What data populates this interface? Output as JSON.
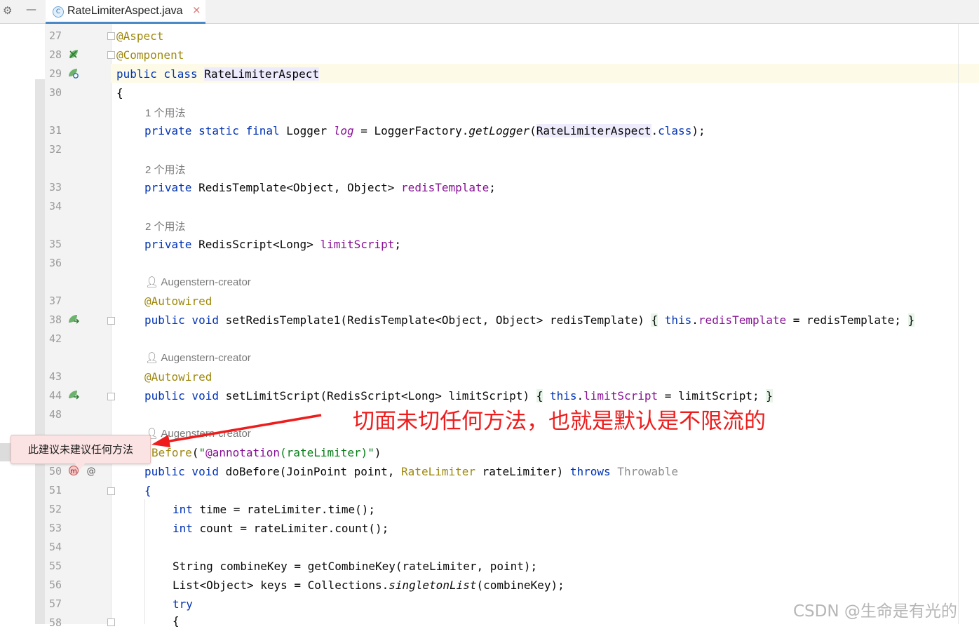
{
  "editor": {
    "tab": {
      "icon": "class-file-icon",
      "filename": "RateLimiterAspect.java",
      "close_glyph": "×"
    },
    "toolbar": {
      "settings_glyph": "⚙",
      "minimize_glyph": "—"
    },
    "gutter": {
      "line_numbers": [
        "27",
        "28",
        "29",
        "30",
        "31",
        "32",
        "33",
        "34",
        "35",
        "36",
        "37",
        "38",
        "42",
        "43",
        "44",
        "48",
        "50",
        "51",
        "52",
        "53",
        "54",
        "55",
        "56",
        "57",
        "58"
      ]
    },
    "hints": {
      "usages_1": "1 个用法",
      "usages_2": "2 个用法",
      "usages_3": "2 个用法",
      "author_1": "Augenstern-creator",
      "author_2": "Augenstern-creator",
      "author_3": "Augenstern-creator"
    }
  },
  "code": {
    "l27": "@Aspect",
    "l28": "@Component",
    "l29_kw": "public class ",
    "l29_name": "RateLimiterAspect",
    "l30": "{",
    "l31_kw": "private static final ",
    "l31_type": "Logger ",
    "l31_field": "log",
    "l31_eq": " = LoggerFactory.",
    "l31_method": "getLogger",
    "l31_paren": "(",
    "l31_arg": "RateLimiterAspect",
    "l31_dot": ".",
    "l31_class": "class",
    "l31_end": ");",
    "l33_kw": "private ",
    "l33_type": "RedisTemplate<Object, Object> ",
    "l33_field": "redisTemplate",
    "l33_end": ";",
    "l35_kw": "private ",
    "l35_type": "RedisScript<Long> ",
    "l35_field": "limitScript",
    "l35_end": ";",
    "l37": "@Autowired",
    "l38_kw": "public void ",
    "l38_sig": "setRedisTemplate1(RedisTemplate<Object, Object> redisTemplate) ",
    "l38_lb": "{",
    "l38_this": " this",
    "l38_dot": ".",
    "l38_field": "redisTemplate",
    "l38_rest": " = redisTemplate; ",
    "l38_rb": "}",
    "l43": "@Autowired",
    "l44_kw": "public void ",
    "l44_sig": "setLimitScript(RedisScript<Long> limitScript) ",
    "l44_lb": "{",
    "l44_this": " this",
    "l44_dot": ".",
    "l44_field": "limitScript",
    "l44_rest": " = limitScript; ",
    "l44_rb": "}",
    "l49_an": "Before",
    "l49_open": "(",
    "l49_str1": "\"",
    "l49_ann": "@annotation",
    "l49_str2": "(rateLimiter)\"",
    "l49_close": ")",
    "l50_kw": "public void ",
    "l50_sig": "doBefore(JoinPoint point, ",
    "l50_ann": "RateLimiter",
    "l50_rest": " rateLimiter) ",
    "l50_throws": "throws",
    "l50_exc": " Throwable",
    "l51": "{",
    "l52_kw": "int",
    "l52_rest": " time = rateLimiter.time();",
    "l53_kw": "int",
    "l53_rest": " count = rateLimiter.count();",
    "l55": "String combineKey = getCombineKey(rateLimiter, point);",
    "l56_a": "List<Object> keys = Collections.",
    "l56_m": "singletonList",
    "l56_b": "(combineKey);",
    "l57": "try",
    "l58": "{"
  },
  "annotations": {
    "red_comment": "切面未切任何方法，也就是默认是不限流的",
    "tooltip": "此建议未建议任何方法",
    "arrow_color": "#ee1c1c"
  },
  "watermark": "CSDN @生命是有光的",
  "colors": {
    "keyword": "#0033b3",
    "annotation": "#9e880d",
    "field": "#871094",
    "string": "#067d17",
    "red": "#ee1c1c"
  }
}
